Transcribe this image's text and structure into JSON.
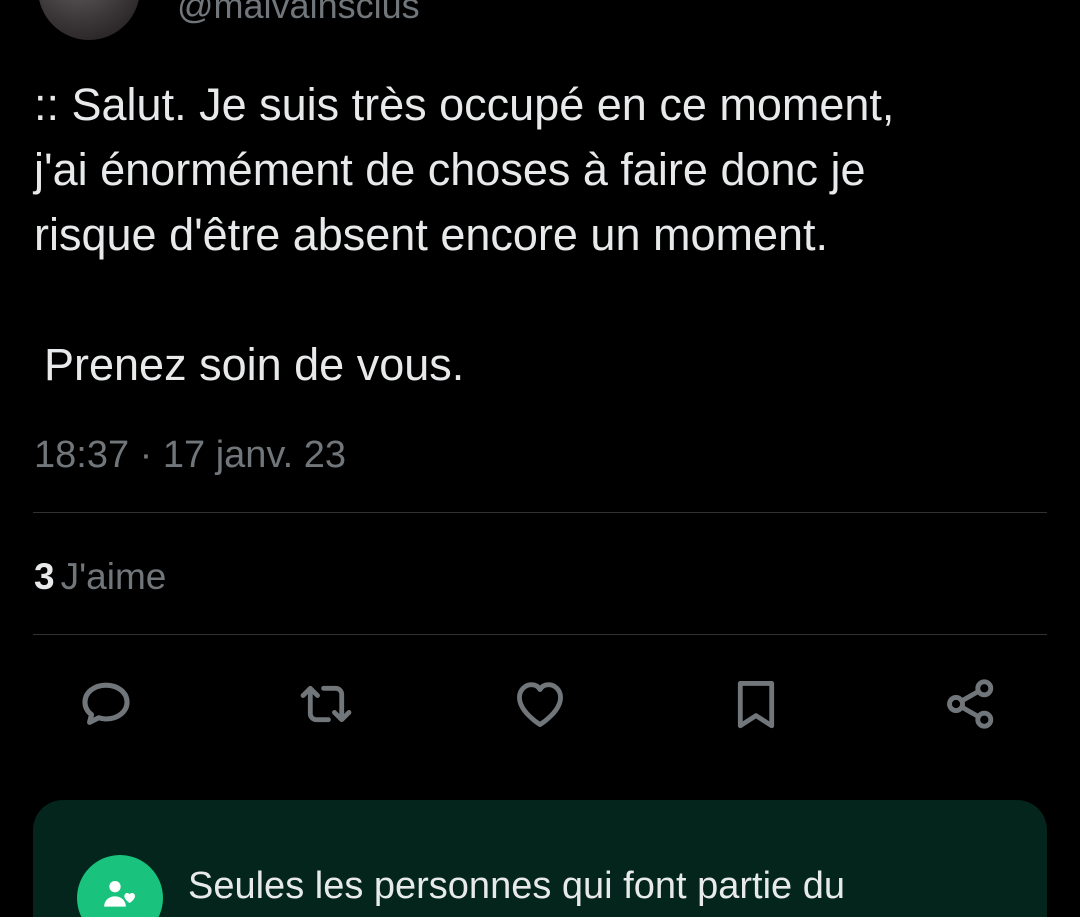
{
  "author": {
    "handle": "@malvainsclus"
  },
  "tweet": {
    "lines": [
      ":: Salut. Je suis très occupé en ce moment,",
      "j'ai énormément de choses à faire donc je",
      "risque d'être absent encore un moment.",
      "Prenez soin de vous."
    ],
    "timestamp": "18:37 · 17 janv. 23"
  },
  "stats": {
    "likes_count": "3",
    "likes_label": "J'aime"
  },
  "actions": [
    {
      "name": "reply",
      "icon": "reply-icon"
    },
    {
      "name": "retweet",
      "icon": "retweet-icon"
    },
    {
      "name": "like",
      "icon": "heart-icon"
    },
    {
      "name": "bookmark",
      "icon": "bookmark-icon"
    },
    {
      "name": "share",
      "icon": "share-icon"
    }
  ],
  "community_notice": {
    "text": "Seules les personnes qui font partie du",
    "icon": "community-people-icon"
  },
  "colors": {
    "background": "#000000",
    "text_primary": "#e7e9ea",
    "text_secondary": "#71767b",
    "divider": "#2f3336",
    "community_card": "#03251c",
    "community_accent": "#19c37d"
  }
}
